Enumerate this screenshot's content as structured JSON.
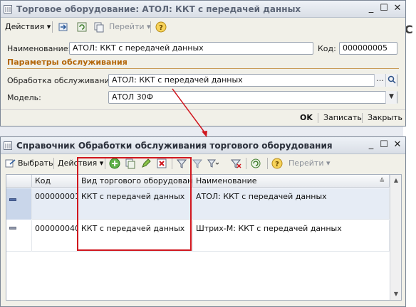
{
  "background": {
    "partial_char": "С"
  },
  "window1": {
    "title": "Торговое оборудование: АТОЛ: ККТ с передачей данных",
    "toolbar": {
      "actions": "Действия",
      "go": "Перейти"
    },
    "name_label": "Наименование:",
    "name_value": "АТОЛ: ККТ с передачей данных",
    "code_label": "Код:",
    "code_value": "000000005",
    "section_title": "Параметры обслуживания",
    "service_label": "Обработка обслуживания:",
    "service_value": "АТОЛ: ККТ с передачей данных",
    "model_label": "Модель:",
    "model_value": "АТОЛ 30Ф",
    "buttons": {
      "ok": "OK",
      "save": "Записать",
      "close": "Закрыть"
    }
  },
  "window2": {
    "title": "Справочник Обработки обслуживания торгового оборудования",
    "toolbar": {
      "select": "Выбрать",
      "actions": "Действия",
      "go": "Перейти"
    },
    "columns": [
      "Код",
      "Вид торгового оборудован...",
      "Наименование"
    ],
    "rows": [
      {
        "code": "000000001",
        "kind": "ККТ с передачей данных",
        "name": "АТОЛ: ККТ с передачей данных"
      },
      {
        "code": "000000040",
        "kind": "ККТ с передачей данных",
        "name": "Штрих-М: ККТ с передачей данных"
      }
    ]
  },
  "colors": {
    "highlight": "#d0161e",
    "section": "#b3660a"
  }
}
